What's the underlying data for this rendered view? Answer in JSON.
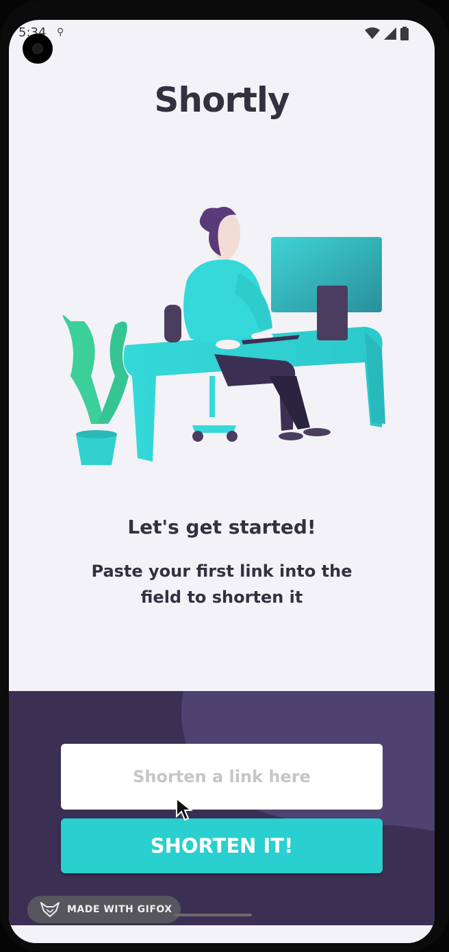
{
  "status_bar": {
    "time": "5:34"
  },
  "app": {
    "title": "Shortly"
  },
  "intro": {
    "heading": "Let's get started!",
    "subtext": "Paste your first link into the field to shorten it"
  },
  "shortener": {
    "input_placeholder": "Shorten a link here",
    "input_value": "",
    "button_label": "SHORTEN IT!"
  },
  "watermark": {
    "label": "MADE WITH GIFOX"
  },
  "colors": {
    "background": "#f3f2f7",
    "title_text": "#34313f",
    "panel": "#3b3054",
    "accent": "#2acfcf",
    "plant": "#3ccf9a"
  },
  "icons": [
    "wifi-icon",
    "cell-signal-icon",
    "battery-icon",
    "cursor-arrow-icon",
    "gifox-logo-icon"
  ]
}
